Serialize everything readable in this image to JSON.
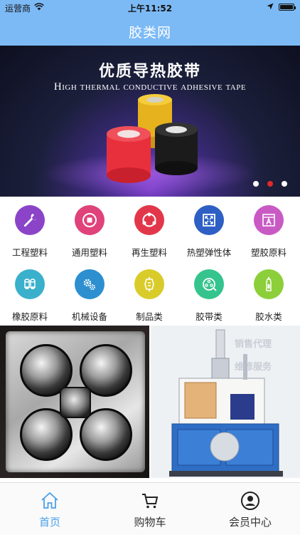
{
  "status_bar": {
    "carrier": "运营商",
    "time": "上午11:52"
  },
  "nav": {
    "title": "胶类网"
  },
  "banner": {
    "title_cn": "优质导热胶带",
    "title_en": "High thermal conductive adhesive tape",
    "page_count": 3,
    "active_page": 2
  },
  "categories": [
    {
      "label": "工程塑料",
      "icon": "wrench-icon",
      "color": "#8b44c8"
    },
    {
      "label": "通用塑料",
      "icon": "stop-circle-icon",
      "color": "#e0427a"
    },
    {
      "label": "再生塑料",
      "icon": "recycle-icon",
      "color": "#e2374a"
    },
    {
      "label": "热塑弹性体",
      "icon": "expand-arrows-icon",
      "color": "#2e5fc4"
    },
    {
      "label": "塑胶原料",
      "icon": "document-a-icon",
      "color": "#c95ac4"
    },
    {
      "label": "橡胶原料",
      "icon": "rubber-rolls-icon",
      "color": "#3ab0cc"
    },
    {
      "label": "机械设备",
      "icon": "gears-icon",
      "color": "#2d8fd0"
    },
    {
      "label": "制品类",
      "icon": "product-tag-icon",
      "color": "#d9cc2a"
    },
    {
      "label": "胶带类",
      "icon": "tape-reel-icon",
      "color": "#35c48e"
    },
    {
      "label": "胶水类",
      "icon": "glue-bottle-icon",
      "color": "#8ccf3a"
    }
  ],
  "products": {
    "left": "bathroom-heater-image",
    "right": "injection-molding-machine-image",
    "right_sign_1": "销售代理",
    "right_sign_2": "维修服务"
  },
  "tabbar": {
    "items": [
      {
        "label": "首页",
        "icon": "home-icon",
        "active": true
      },
      {
        "label": "购物车",
        "icon": "cart-icon",
        "active": false
      },
      {
        "label": "会员中心",
        "icon": "user-icon",
        "active": false
      }
    ]
  },
  "colors": {
    "header": "#7cbaf5",
    "tab_active": "#4aa0e8",
    "dot_active": "#e02a2a"
  }
}
